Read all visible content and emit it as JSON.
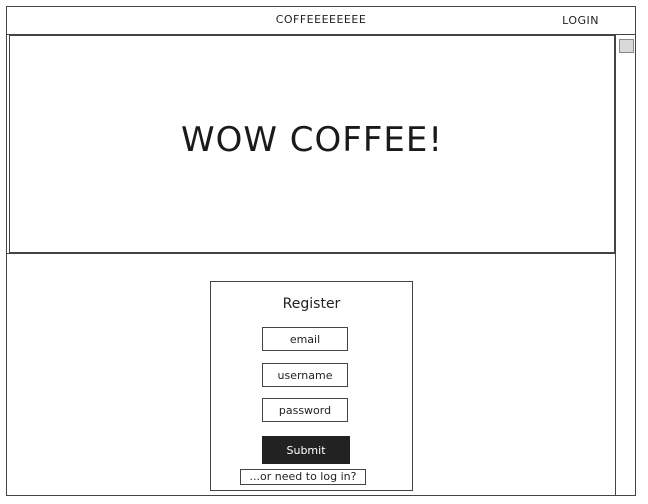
{
  "topbar": {
    "brand": "COFFEEEEEEEE",
    "login_label": "LOGIN"
  },
  "hero": {
    "title": "WOW COFFEE!"
  },
  "register": {
    "title": "Register",
    "email_placeholder": "email",
    "username_placeholder": "username",
    "password_placeholder": "password",
    "submit_label": "Submit",
    "login_link": "...or need to log in?"
  }
}
